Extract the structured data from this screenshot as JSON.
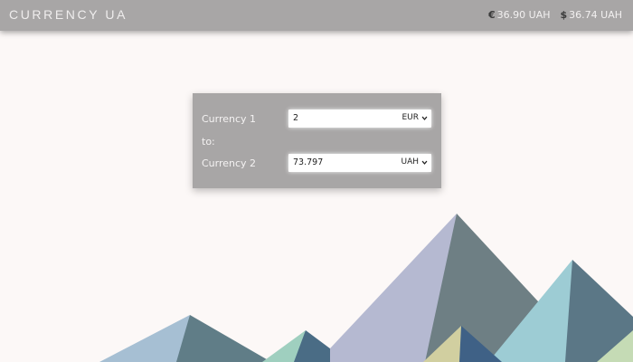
{
  "header": {
    "logo": "CURRENCY UA",
    "rates": [
      {
        "icon": "euro-icon",
        "symbol": "€",
        "value": "36.90 UAH"
      },
      {
        "icon": "dollar-icon",
        "symbol": "$",
        "value": "36.74 UAH"
      }
    ]
  },
  "converter": {
    "currency1_label": "Currency 1",
    "currency1_value": "2",
    "currency1_code": "EUR",
    "to_label": "to:",
    "currency2_label": "Currency 2",
    "currency2_value": "73.797",
    "currency2_code": "UAH"
  },
  "colors": {
    "header_bg": "#a8a6a6",
    "card_bg": "#a8a6a6",
    "page_bg": "#fcf8f7"
  }
}
